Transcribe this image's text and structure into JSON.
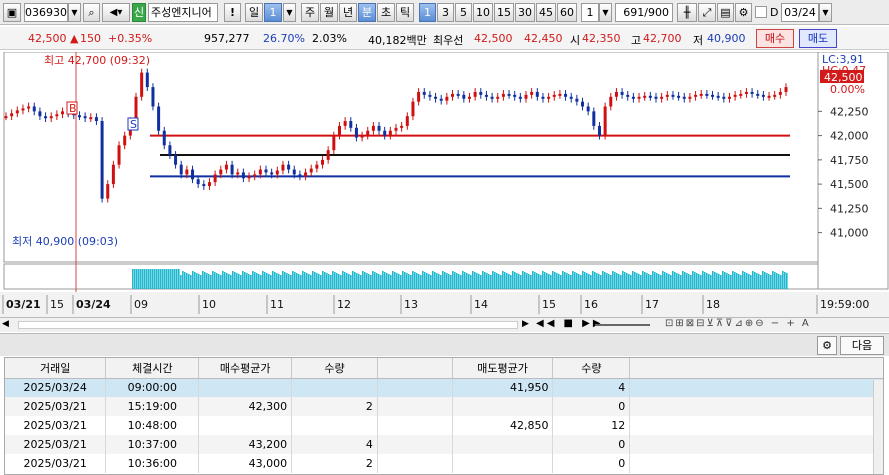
{
  "toolbar": {
    "code": "036930",
    "new_label": "신",
    "name": "주성엔지니어",
    "alert": "!",
    "period": [
      "일",
      "1",
      "주",
      "월",
      "년",
      "분",
      "초",
      "틱"
    ],
    "intervals": [
      "1",
      "3",
      "5",
      "10",
      "15",
      "30",
      "45",
      "60"
    ],
    "count": "1",
    "position": "691/900",
    "date": "03/24",
    "d_label": "D"
  },
  "quote": {
    "price": "42,500",
    "change": "150",
    "pct": "+0.35%",
    "volume": "957,277",
    "turnover": "26.70%",
    "rate2": "2.03%",
    "amount": "40,182백만",
    "best_label": "최우선",
    "best_ask": "42,500",
    "best_bid": "42,450",
    "open_label": "시",
    "open": "42,350",
    "high_label": "고",
    "high": "42,700",
    "low_label": "저",
    "low": "40,900",
    "buy_label": "매수",
    "sell_label": "매도"
  },
  "chart_data": {
    "type": "candlestick",
    "title": "",
    "y_ticks": [
      "42,250",
      "42,000",
      "41,750",
      "41,500",
      "41,250",
      "41,000"
    ],
    "y_range": [
      40800,
      42800
    ],
    "x_labels": [
      "03/21",
      "15",
      "03/24",
      "09",
      "10",
      "11",
      "12",
      "13",
      "14",
      "15",
      "16",
      "17",
      "18",
      "19:59:00"
    ],
    "high_note": "최고 42,700 (09:32)",
    "low_note": "최저 40,900 (09:03)",
    "lc_label": "LC:3,91",
    "hc_label": "HC:0.47",
    "current_price": "42,500",
    "current_pct": "0.00%",
    "avg_buy_line": 42000,
    "mid_line": 41800,
    "avg_sell_line": 41580,
    "markers": [
      "B",
      "S"
    ],
    "series": [
      {
        "values": [
          42200,
          42230,
          42260,
          42280,
          42300,
          42250,
          42200,
          42180,
          42200,
          42220,
          42250,
          42230,
          42210,
          42200,
          42180,
          42190,
          42150,
          41350,
          41500,
          41700,
          41900,
          42000,
          42150,
          42400,
          42650,
          42500,
          42300,
          42050,
          41900,
          41800,
          41700,
          41600,
          41650,
          41550,
          41500,
          41480,
          41520,
          41600,
          41650,
          41700,
          41600,
          41620,
          41560,
          41580,
          41600,
          41650,
          41620,
          41600,
          41640,
          41700,
          41650,
          41600,
          41580,
          41620,
          41660,
          41700,
          41750,
          41850,
          42000,
          42100,
          42150,
          42080,
          41980,
          42000,
          42050,
          42100,
          42050,
          42000,
          42050,
          42080,
          42100,
          42200,
          42350,
          42450,
          42420,
          42400,
          42380,
          42360,
          42400,
          42430,
          42420,
          42380,
          42400,
          42450,
          42420,
          42400,
          42380,
          42400,
          42430,
          42420,
          42400,
          42380,
          42420,
          42450,
          42400,
          42380,
          42400,
          42420,
          42430,
          42400,
          42380,
          42350,
          42300,
          42250,
          42100,
          42000,
          42300,
          42400,
          42450,
          42420,
          42400,
          42380,
          42400,
          42410,
          42400,
          42380,
          42400,
          42420,
          42410,
          42400,
          42380,
          42400,
          42420,
          42430,
          42420,
          42410,
          42400,
          42380,
          42400,
          42420,
          42430,
          42450,
          42430,
          42420,
          42400,
          42410,
          42420,
          42450,
          42500
        ]
      }
    ]
  },
  "table": {
    "headers": [
      "거래일",
      "체결시간",
      "매수평균가",
      "수량",
      "",
      "매도평균가",
      "수량"
    ],
    "rows": [
      [
        "2025/03/24",
        "09:00:00",
        "",
        "",
        "",
        "41,950",
        "4"
      ],
      [
        "2025/03/21",
        "15:19:00",
        "42,300",
        "2",
        "",
        "",
        "0"
      ],
      [
        "2025/03/21",
        "10:48:00",
        "",
        "",
        "",
        "42,850",
        "12"
      ],
      [
        "2025/03/21",
        "10:37:00",
        "43,200",
        "4",
        "",
        "",
        "0"
      ],
      [
        "2025/03/21",
        "10:36:00",
        "43,000",
        "2",
        "",
        "",
        "0"
      ]
    ],
    "next_label": "다음"
  }
}
